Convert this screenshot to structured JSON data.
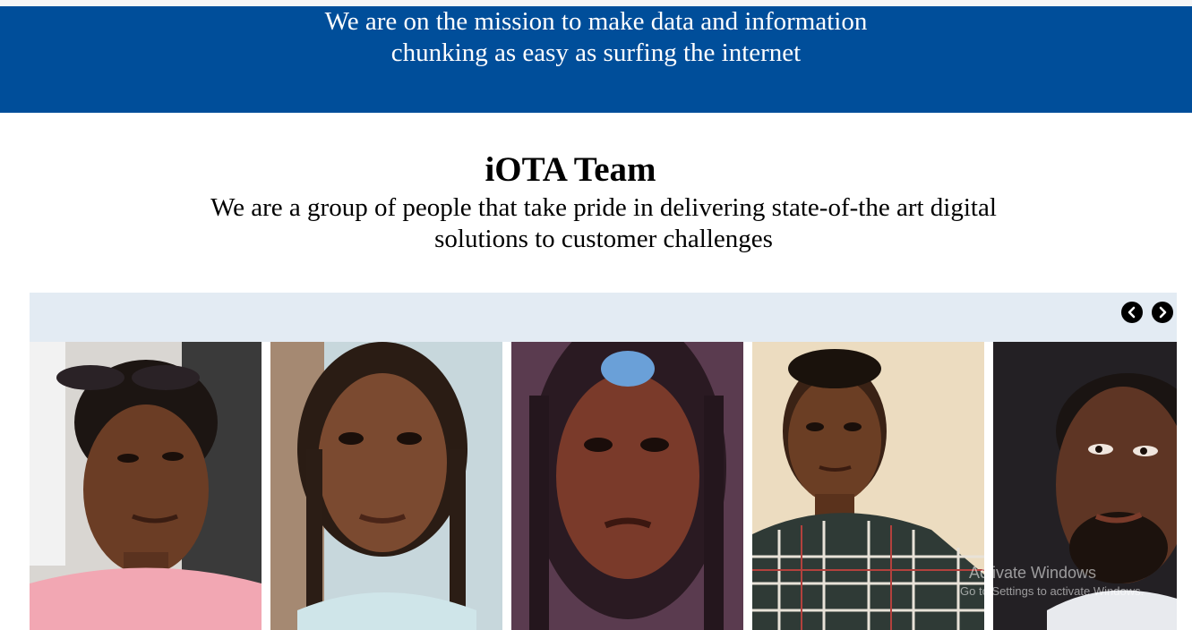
{
  "hero": {
    "line1": "We are on the mission to make data and information",
    "line2": "chunking as easy as surfing the internet",
    "bg_color": "#004e9a"
  },
  "team": {
    "title": "iOTA Team",
    "desc_line1": "We are a group of people that take pride in delivering state-of-the art digital",
    "desc_line2": "solutions to customer challenges"
  },
  "carousel": {
    "prev_icon": "chevron-left-icon",
    "next_icon": "chevron-right-icon",
    "members": [
      {
        "photo": "team-member-photo-1"
      },
      {
        "photo": "team-member-photo-2"
      },
      {
        "photo": "team-member-photo-3"
      },
      {
        "photo": "team-member-photo-4"
      },
      {
        "photo": "team-member-photo-5"
      }
    ]
  },
  "watermark": {
    "line1": "Activate Windows",
    "line2": "Go to Settings to activate Windows."
  }
}
